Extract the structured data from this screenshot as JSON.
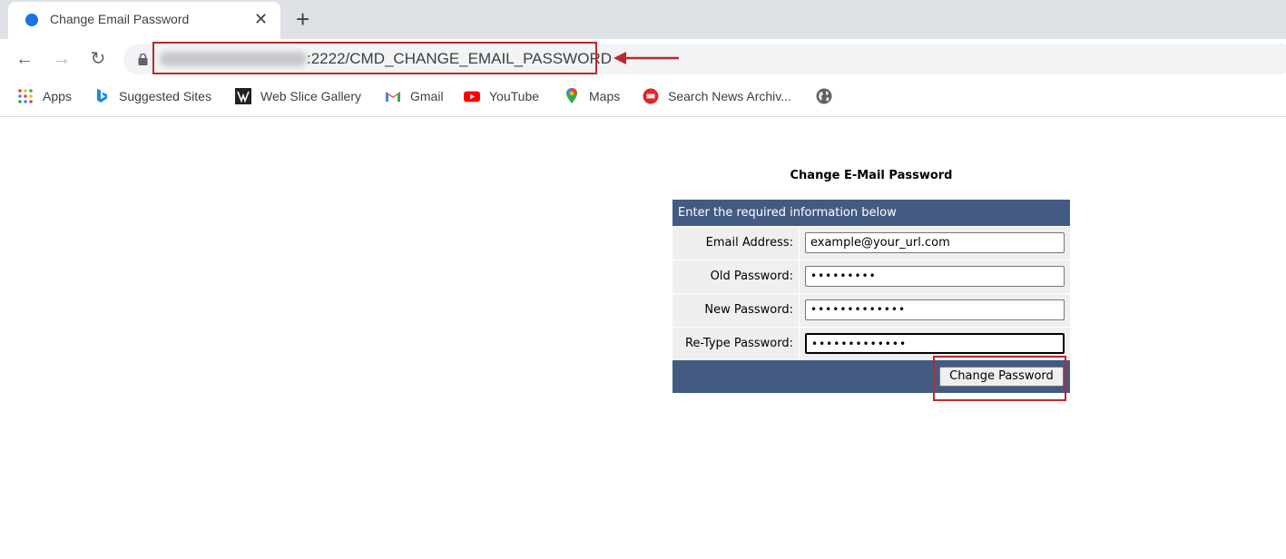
{
  "browser": {
    "tab": {
      "title": "Change Email Password",
      "close": "✕"
    },
    "new_tab": "+",
    "nav": {
      "back": "←",
      "forward": "→",
      "reload": "↻"
    },
    "address": {
      "url_visible": ":2222/CMD_CHANGE_EMAIL_PASSWORD"
    },
    "bookmarks": [
      {
        "label": "Apps",
        "icon": "apps-grid-icon"
      },
      {
        "label": "Suggested Sites",
        "icon": "bing-icon"
      },
      {
        "label": "Web Slice Gallery",
        "icon": "web-slice-icon"
      },
      {
        "label": "Gmail",
        "icon": "gmail-icon"
      },
      {
        "label": "YouTube",
        "icon": "youtube-icon"
      },
      {
        "label": "Maps",
        "icon": "maps-icon"
      },
      {
        "label": "Search News Archiv...",
        "icon": "news-archive-icon"
      }
    ]
  },
  "form": {
    "title": "Change E-Mail Password",
    "header": "Enter the required information below",
    "fields": [
      {
        "label": "Email Address:",
        "value": "example@your_url.com"
      },
      {
        "label": "Old Password:",
        "value": "•••••••••"
      },
      {
        "label": "New Password:",
        "value": "•••••••••••••"
      },
      {
        "label": "Re-Type Password:",
        "value": "•••••••••••••"
      }
    ],
    "submit_label": "Change Password"
  },
  "colors": {
    "header_bg": "#435b82",
    "annotation_red": "#c0262d"
  }
}
